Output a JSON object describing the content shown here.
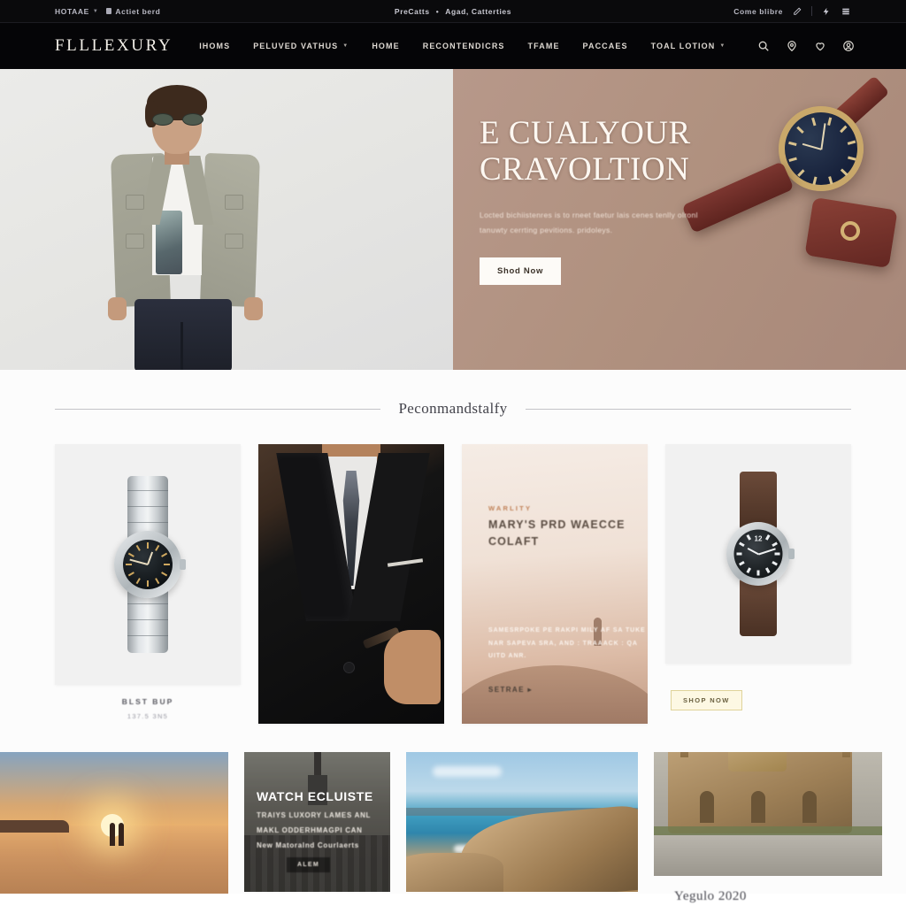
{
  "topbar": {
    "left": [
      {
        "label": "HOTAAE",
        "has_caret": true
      },
      {
        "label": "Actiet berd",
        "has_icon": true
      }
    ],
    "center": {
      "first": "PreCatts",
      "separator": "•",
      "second": "Agad, Catterties"
    },
    "right": {
      "label": "Come blibre",
      "icons": [
        "pencil-icon",
        "lightning-icon",
        "grid-icon"
      ]
    }
  },
  "nav": {
    "brand": "FLLLEXURY",
    "links": [
      {
        "label": "IHOMS",
        "caret": false
      },
      {
        "label": "PELUVED VATHUS",
        "caret": true
      },
      {
        "label": "HOME",
        "caret": false
      },
      {
        "label": "RECONTENDICRS",
        "caret": false
      },
      {
        "label": "TFAME",
        "caret": false
      },
      {
        "label": "PACCAES",
        "caret": false
      },
      {
        "label": "TOAL LOTION",
        "caret": true
      }
    ],
    "icons": [
      "search-icon",
      "location-pin-icon",
      "heart-icon",
      "account-icon"
    ]
  },
  "hero": {
    "title_line1": "E CUALYOUR",
    "title_line2": "CRAVOLTION",
    "body": "Locted bichiistenres is to rneet faetur lais cenes tenlly olronl tanuwty cerrting pevitions. pridoleys.",
    "cta": "Shod Now",
    "bg_color": "#b0917f"
  },
  "section": {
    "title": "Peconmandstalfy"
  },
  "products": [
    {
      "name": "steel-bracelet-watch",
      "title": "BLST BUP",
      "price": "137.5 3N5",
      "cta": null
    },
    {
      "name": "suited-man-editorial",
      "title": null,
      "price": null,
      "cta": null
    },
    {
      "name": "desert-poster",
      "eyebrow": "WARLITY",
      "title": "MARY'S PRD WAECCE COLAFT",
      "body": "SAMESRPOKE PE RAKPI MILY AF SA TUKE NAR SAPEVA SRA, AND : TRAAACK : QA UITD ANR.",
      "link": "SETRAE ▸"
    },
    {
      "name": "leather-strap-watch",
      "title": null,
      "price": null,
      "cta": "SHOP NOW"
    }
  ],
  "strip": [
    {
      "name": "sunset-beach-photo",
      "caption": null
    },
    {
      "name": "city-skyline-promo",
      "title": "WATCH ECLUISTE",
      "body": "TRAIYS LUXORY LAMES ANL MAKL ODDERHMAGPI CAN New Matoralnd Courlaerts",
      "button": "ALEM"
    },
    {
      "name": "coastal-cliff-photo",
      "caption": null
    },
    {
      "name": "historic-building-photo",
      "caption": null
    }
  ],
  "footnote": "Yegulo 2020"
}
